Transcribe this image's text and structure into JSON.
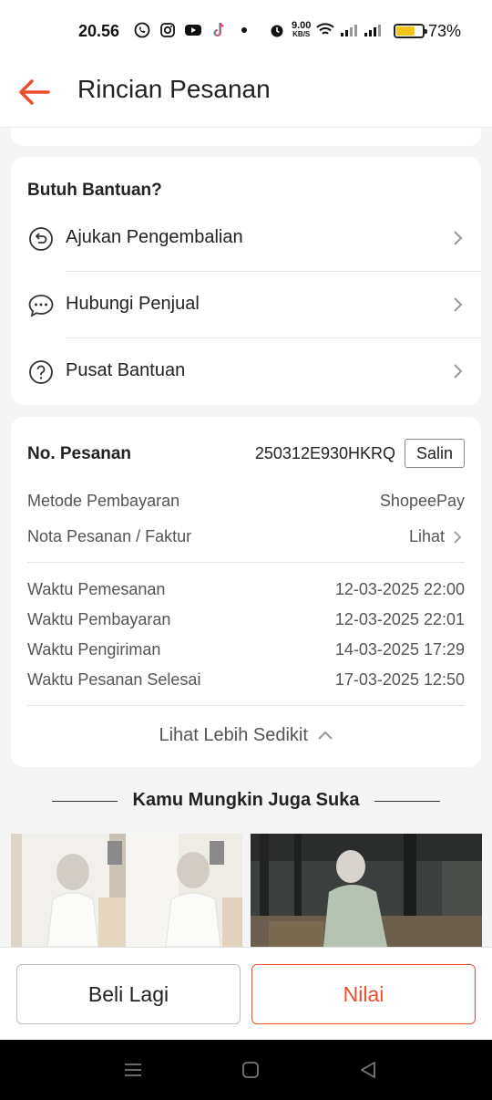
{
  "status_bar": {
    "time": "20.56",
    "net_speed_value": "9.00",
    "net_speed_unit": "KB/S",
    "battery_percent": "73%",
    "battery_level": 0.73,
    "battery_color": "#f5c518"
  },
  "header": {
    "title": "Rincian Pesanan",
    "back_icon": "arrow-left-icon",
    "accent_color": "#ee4d2d"
  },
  "help": {
    "title": "Butuh Bantuan?",
    "items": [
      {
        "label": "Ajukan Pengembalian",
        "icon": "return-icon"
      },
      {
        "label": "Hubungi Penjual",
        "icon": "chat-icon"
      },
      {
        "label": "Pusat Bantuan",
        "icon": "help-icon"
      }
    ]
  },
  "order": {
    "label": "No. Pesanan",
    "number": "250312E930HKRQ",
    "copy_label": "Salin",
    "payment_method_label": "Metode Pembayaran",
    "payment_method_value": "ShopeePay",
    "invoice_label": "Nota Pesanan / Faktur",
    "invoice_value": "Lihat",
    "times": [
      {
        "label": "Waktu Pemesanan",
        "value": "12-03-2025 22:00"
      },
      {
        "label": "Waktu Pembayaran",
        "value": "12-03-2025 22:01"
      },
      {
        "label": "Waktu Pengiriman",
        "value": "14-03-2025 17:29"
      },
      {
        "label": "Waktu Pesanan Selesai",
        "value": "17-03-2025 12:50"
      }
    ],
    "show_less_label": "Lihat Lebih Sedikit"
  },
  "recommendations": {
    "title": "Kamu Mungkin Juga Suka"
  },
  "actions": {
    "buy_again_label": "Beli Lagi",
    "rate_label": "Nilai"
  }
}
